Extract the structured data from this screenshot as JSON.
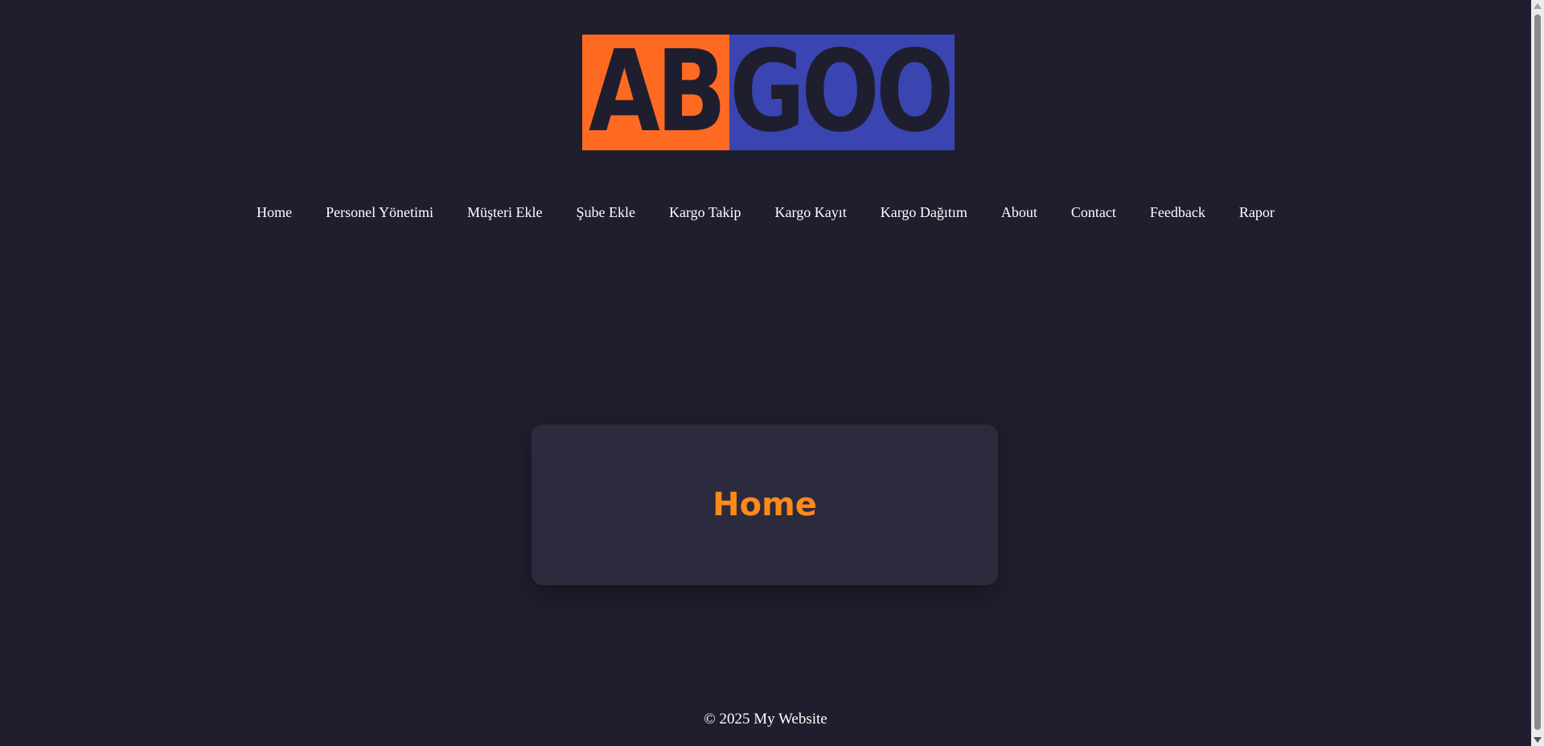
{
  "logo": {
    "left_text": "AB",
    "right_text": "GOO",
    "colors": {
      "left": "#ff6a22",
      "right": "#3a45b2",
      "letters": "#1f1e2e"
    }
  },
  "nav": {
    "items": [
      {
        "label": "Home"
      },
      {
        "label": "Personel Yönetimi"
      },
      {
        "label": "Müşteri Ekle"
      },
      {
        "label": "Şube Ekle"
      },
      {
        "label": "Kargo Takip"
      },
      {
        "label": "Kargo Kayıt"
      },
      {
        "label": "Kargo Dağıtım"
      },
      {
        "label": "About"
      },
      {
        "label": "Contact"
      },
      {
        "label": "Feedback"
      },
      {
        "label": "Rapor"
      }
    ]
  },
  "main": {
    "title": "Home",
    "title_color": "#ff8a1a"
  },
  "footer": {
    "text": "© 2025 My Website"
  },
  "theme": {
    "background": "#1f1e2e",
    "card_background": "#2c2b3e"
  }
}
